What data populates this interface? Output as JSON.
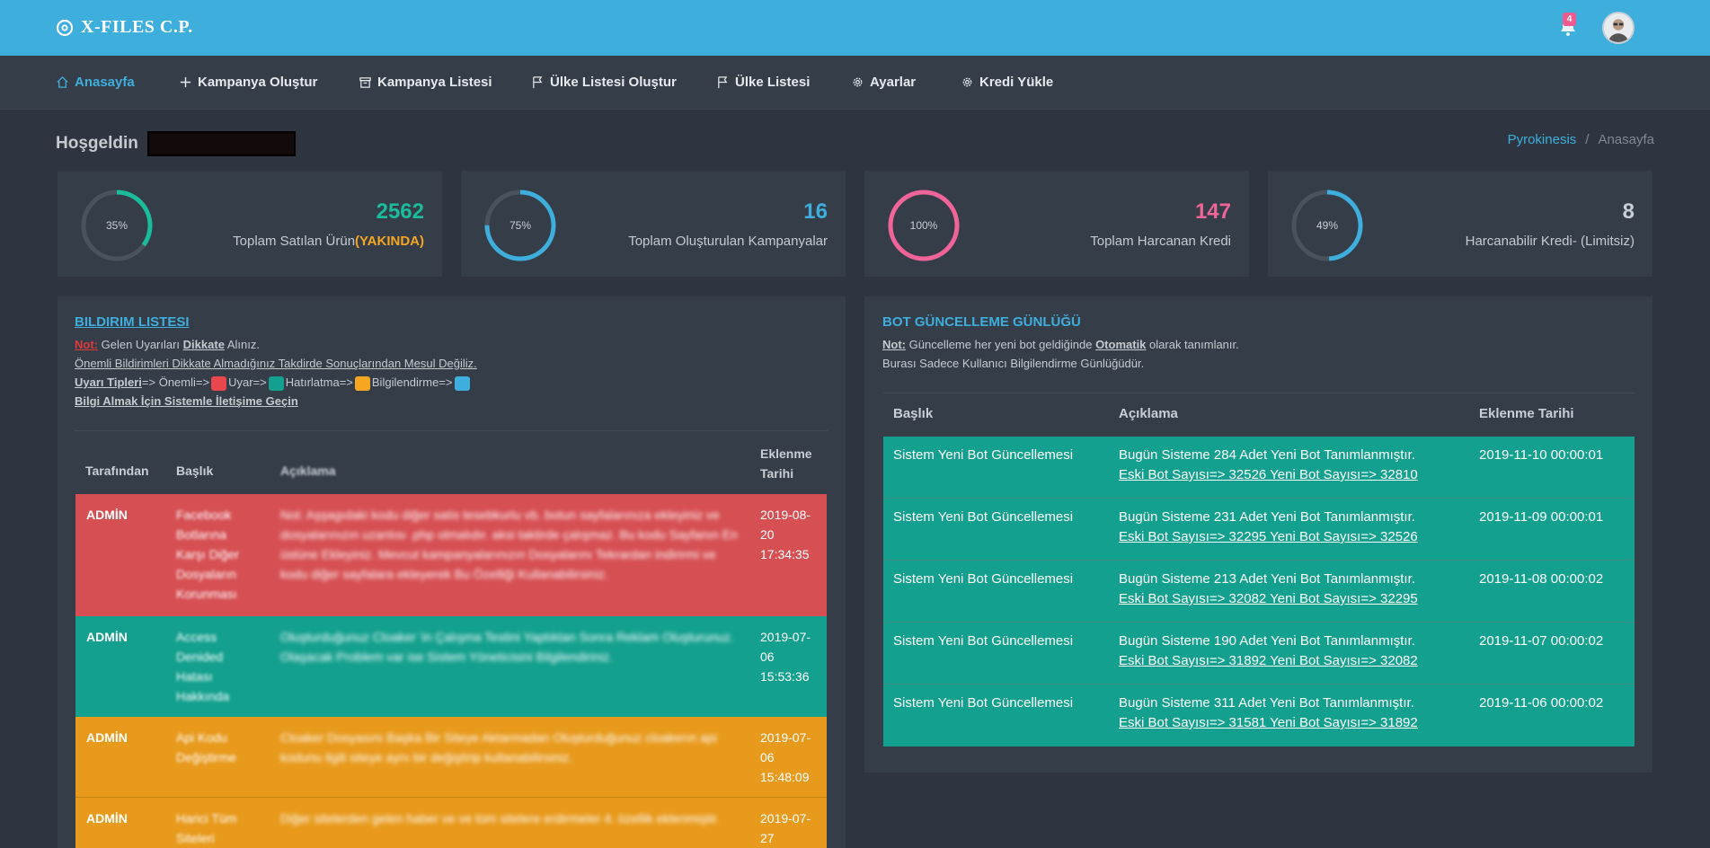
{
  "brand": {
    "name": "X-FILES C.P."
  },
  "header": {
    "notification_count": "4"
  },
  "nav": [
    {
      "label": "Anasayfa",
      "icon": "home-icon",
      "active": true
    },
    {
      "label": "Kampanya Oluştur",
      "icon": "plus-icon"
    },
    {
      "label": "Kampanya Listesi",
      "icon": "archive-icon"
    },
    {
      "label": "Ülke Listesi Oluştur",
      "icon": "flag-icon"
    },
    {
      "label": "Ülke Listesi",
      "icon": "flag-icon"
    },
    {
      "label": "Ayarlar",
      "icon": "gear-icon"
    },
    {
      "label": "Kredi Yükle",
      "icon": "gear-icon"
    }
  ],
  "welcome": {
    "text": "Hoşgeldin"
  },
  "breadcrumb": {
    "root": "Pyrokinesis",
    "separator": "/",
    "current": "Anasayfa"
  },
  "stats": [
    {
      "percent_label": "35%",
      "percent": 35,
      "value": "2562",
      "label": "Toplam Satılan Ürün",
      "highlight": "(YAKINDA)",
      "color": "#1abc9c"
    },
    {
      "percent_label": "75%",
      "percent": 75,
      "value": "16",
      "label": "Toplam Oluşturulan Kampanyalar",
      "highlight": "",
      "color": "#3eaedc"
    },
    {
      "percent_label": "100%",
      "percent": 100,
      "value": "147",
      "label": "Toplam Harcanan Kredi",
      "highlight": "",
      "color": "#f0649a"
    },
    {
      "percent_label": "49%",
      "percent": 49,
      "value": "8",
      "label": "Harcanabilir Kredi- (Limitsiz)",
      "highlight": "",
      "color": "#3eaedc"
    }
  ],
  "notifications": {
    "title": "BILDIRIM LISTESI",
    "note_label": "Not:",
    "note_pre": "Gelen Uyarıları",
    "note_bold": "Dikkate",
    "note_post": "Alınız.",
    "warning_line": "Önemli Bildirimleri Dikkate Almadığınız Takdirde Sonuçlarından Mesul Değiliz.",
    "types_label": "Uyarı Tipleri",
    "types_arrow": "=>",
    "types": [
      {
        "name": "Önemli=>",
        "color": "#e8484d"
      },
      {
        "name": "Uyar=>",
        "color": "#14a08e"
      },
      {
        "name": "Hatırlatma=>",
        "color": "#f5a623"
      },
      {
        "name": "Bilgilendirme=>",
        "color": "#3eaedc"
      }
    ],
    "contact": "Bilgi Almak İçin Sistemle İletişime Geçin",
    "columns": {
      "by": "Tarafından",
      "title": "Başlık",
      "desc": "Açıklama",
      "date": "Eklenme Tarihi"
    },
    "rows": [
      {
        "by": "ADMİN",
        "title": "Facebook Botlarına Karşı Diğer Dosyaların Korunması",
        "desc": "Not: Aşşagıdaki kodu diğer satis tesebkurlu vb. botun sayfalarınıza ekleyiniz ve dosyalarınızın uzantısı .php olmalıdır. aksi taktirde çalışmaz. Bu kodu Sayfanın En üstüne Ekleyiniz. Mevcut kampanyalarınızın Dosyalarını Tekrardan indirirmi ve kodu diğer sayfalara ekleyerek Bu Özelliği Kullanabilirsiniz.",
        "date": "2019-08-20 17:34:35",
        "color": "#d64f53"
      },
      {
        "by": "ADMİN",
        "title": "Access Denided Hatası Hakkında",
        "desc": "Oluşturduğunuz Cloaker 'in Çalışma Testini Yaptıktan Sonra Reklam Oluşturunuz. Olaşacak Problem var ise Sistem Yöneticisini Bilgilendiriniz.",
        "date": "2019-07-06 15:53:36",
        "color": "#14a08e"
      },
      {
        "by": "ADMİN",
        "title": "Api Kodu Değiştirme",
        "desc": "Cloaker Dosyasını Başka Bir Siteye Aktarmadan Oluşturduğunuz cloakerın api kodunu ilgili siteye aynı bir değiştirip kullanabilirsiniz.",
        "date": "2019-07-06 15:48:09",
        "color": "#e89a1c"
      },
      {
        "by": "ADMİN",
        "title": "Harici Tüm Siteleri",
        "desc": "Diğer sitelerden gelen haber ve ve tüm sitelere erdirmeler 4. özellik eklenmiştir.",
        "date": "2019-07-27",
        "color": "#e89a1c"
      }
    ]
  },
  "bot_log": {
    "title": "BOT GÜNCELLEME GÜNLÜĞÜ",
    "note_label": "Not:",
    "note_pre": "Güncelleme her yeni bot geldiğinde",
    "note_bold": "Otomatik",
    "note_post": "olarak tanımlanır.",
    "info_line": "Burası Sadece Kullanıcı Bilgilendirme Günlüğüdür.",
    "columns": {
      "title": "Başlık",
      "desc": "Açıklama",
      "date": "Eklenme Tarihi"
    },
    "rows": [
      {
        "title": "Sistem Yeni Bot Güncellemesi",
        "desc": "Bugün Sisteme 284 Adet Yeni Bot Tanımlanmıştır.",
        "counts": "Eski Bot Sayısı=> 32526 Yeni Bot Sayısı=> 32810",
        "date": "2019-11-10 00:00:01"
      },
      {
        "title": "Sistem Yeni Bot Güncellemesi",
        "desc": "Bugün Sisteme 231 Adet Yeni Bot Tanımlanmıştır.",
        "counts": "Eski Bot Sayısı=> 32295 Yeni Bot Sayısı=> 32526",
        "date": "2019-11-09 00:00:01"
      },
      {
        "title": "Sistem Yeni Bot Güncellemesi",
        "desc": "Bugün Sisteme 213 Adet Yeni Bot Tanımlanmıştır.",
        "counts": "Eski Bot Sayısı=> 32082 Yeni Bot Sayısı=> 32295",
        "date": "2019-11-08 00:00:02"
      },
      {
        "title": "Sistem Yeni Bot Güncellemesi",
        "desc": "Bugün Sisteme 190 Adet Yeni Bot Tanımlanmıştır.",
        "counts": "Eski Bot Sayısı=> 31892 Yeni Bot Sayısı=> 32082",
        "date": "2019-11-07 00:00:02"
      },
      {
        "title": "Sistem Yeni Bot Güncellemesi",
        "desc": "Bugün Sisteme 311 Adet Yeni Bot Tanımlanmıştır.",
        "counts": "Eski Bot Sayısı=> 31581 Yeni Bot Sayısı=> 31892",
        "date": "2019-11-06 00:00:02"
      }
    ]
  }
}
